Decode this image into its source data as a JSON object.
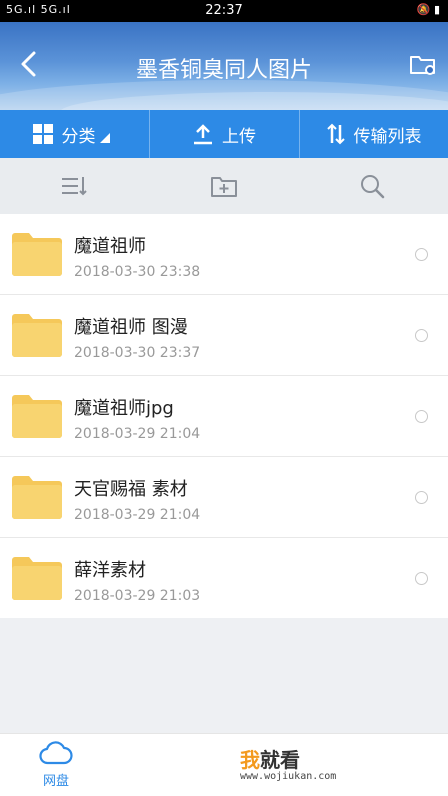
{
  "status_bar": {
    "left": "5G.ıl 5G.ıl",
    "time": "22:37",
    "right": "🔕 ▮"
  },
  "header": {
    "title": "墨香铜臭同人图片"
  },
  "toolbar": {
    "category_label": "分类",
    "upload_label": "上传",
    "transfer_label": "传输列表"
  },
  "files": [
    {
      "name": "魔道祖师",
      "date": "2018-03-30  23:38"
    },
    {
      "name": "魔道祖师 图漫",
      "date": "2018-03-30  23:37"
    },
    {
      "name": "魔道祖师jpg",
      "date": "2018-03-29  21:04"
    },
    {
      "name": "天官赐福 素材",
      "date": "2018-03-29  21:04"
    },
    {
      "name": "薛洋素材",
      "date": "2018-03-29  21:03"
    }
  ],
  "bottom_nav": {
    "netdisk_label": "网盘"
  },
  "watermark": {
    "wo": "我",
    "rest": "就看",
    "url": "www.wojiukan.com"
  },
  "colors": {
    "accent": "#2d8ae6",
    "folder": "#f5c85a"
  }
}
